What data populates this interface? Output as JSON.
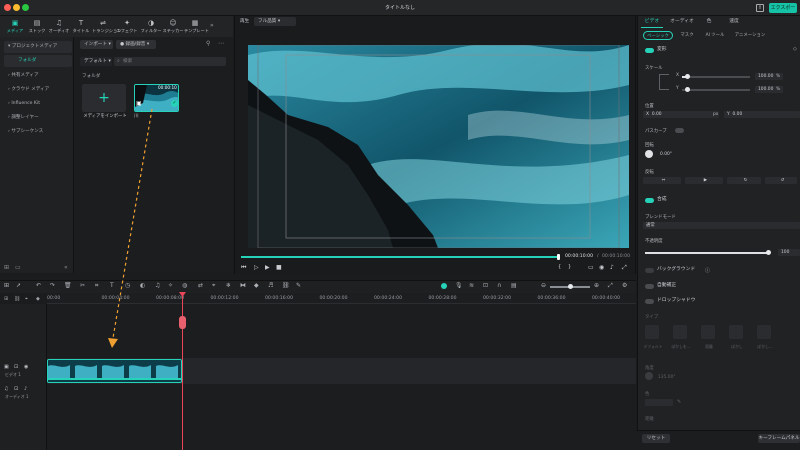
{
  "window": {
    "title": "タイトルなし",
    "export_label": "エクスポート"
  },
  "toolbar": {
    "tabs": [
      {
        "label": "メディア",
        "icon": "media-icon",
        "glyph": "▣"
      },
      {
        "label": "ストック",
        "icon": "stock-icon",
        "glyph": "▤"
      },
      {
        "label": "オーディオ",
        "icon": "audio-icon",
        "glyph": "♫"
      },
      {
        "label": "タイトル",
        "icon": "title-icon",
        "glyph": "T"
      },
      {
        "label": "トランジション",
        "icon": "transition-icon",
        "glyph": "⇌"
      },
      {
        "label": "エフェクト",
        "icon": "effect-icon",
        "glyph": "✦"
      },
      {
        "label": "フィルター",
        "icon": "filter-icon",
        "glyph": "◑"
      },
      {
        "label": "ステッカー",
        "icon": "sticker-icon",
        "glyph": "☺"
      },
      {
        "label": "テンプレート",
        "icon": "template-icon",
        "glyph": "▦"
      }
    ]
  },
  "leftnav": {
    "items": [
      {
        "label": "プロジェクトメディア"
      },
      {
        "label": "フォルダ"
      },
      {
        "label": "共有メディア"
      },
      {
        "label": "クラウド メディア"
      },
      {
        "label": "Influence Kit"
      },
      {
        "label": "調整レイヤー"
      },
      {
        "label": "サブシーケンス"
      }
    ]
  },
  "media": {
    "import_label": "インポート",
    "record_label": "録画/録音",
    "sort_label": "デフォルト",
    "search_placeholder": "検索",
    "folder_label": "フォルダ",
    "import_tile_label": "メディアをインポート",
    "clip_duration": "00:00:10",
    "clip_name": "川"
  },
  "preview": {
    "player_label": "再生",
    "quality_label": "フル品質",
    "current_time": "00:00:10:00",
    "total_time": "00:00:10:00"
  },
  "timeline": {
    "ticks": [
      "00:00",
      "00:00:04:00",
      "00:00:08:00",
      "00:00:12:00",
      "00:00:16:00",
      "00:00:20:00",
      "00:00:24:00",
      "00:00:28:00",
      "00:00:32:00",
      "00:00:36:00",
      "00:00:40:00"
    ],
    "video_track_label": "ビデオ 1",
    "audio_track_label": "オーディオ 1"
  },
  "inspector": {
    "tabs": [
      "ビデオ",
      "オーディオ",
      "色",
      "速度"
    ],
    "subtabs": [
      "ベーシック",
      "マスク",
      "AI ツール",
      "アニメーション"
    ],
    "transform_label": "変形",
    "scale_label": "スケール",
    "scale_x_letter": "X",
    "scale_y_letter": "Y",
    "scale_x": "100.00",
    "scale_y": "100.00",
    "percent": "%",
    "position_label": "位置",
    "pos_x_letter": "X",
    "pos_y_letter": "Y",
    "pos_x": "0.00",
    "pos_y": "0.00",
    "px": "px",
    "path_curve_label": "パスカーブ",
    "rotate_label": "回転",
    "rotate_value": "0.00°",
    "flip_label": "反転",
    "composite_label": "合成",
    "blend_label": "ブレンドモード",
    "blend_value": "通常",
    "opacity_label": "不透明度",
    "opacity_value": "100",
    "background_label": "バックグラウンド",
    "auto_enhance_label": "自動補正",
    "drop_shadow_label": "ドロップシャドウ",
    "type_label": "タイプ",
    "shadow_presets": [
      "デフォルト",
      "ぼかしを…",
      "距離",
      "ぼかし",
      "ぼかし…"
    ],
    "angle_label": "角度",
    "angle_value": "135.00°",
    "color_label": "色",
    "distance_label": "距離",
    "reset_label": "リセット",
    "keyframe_label": "キーフレームパネル"
  }
}
